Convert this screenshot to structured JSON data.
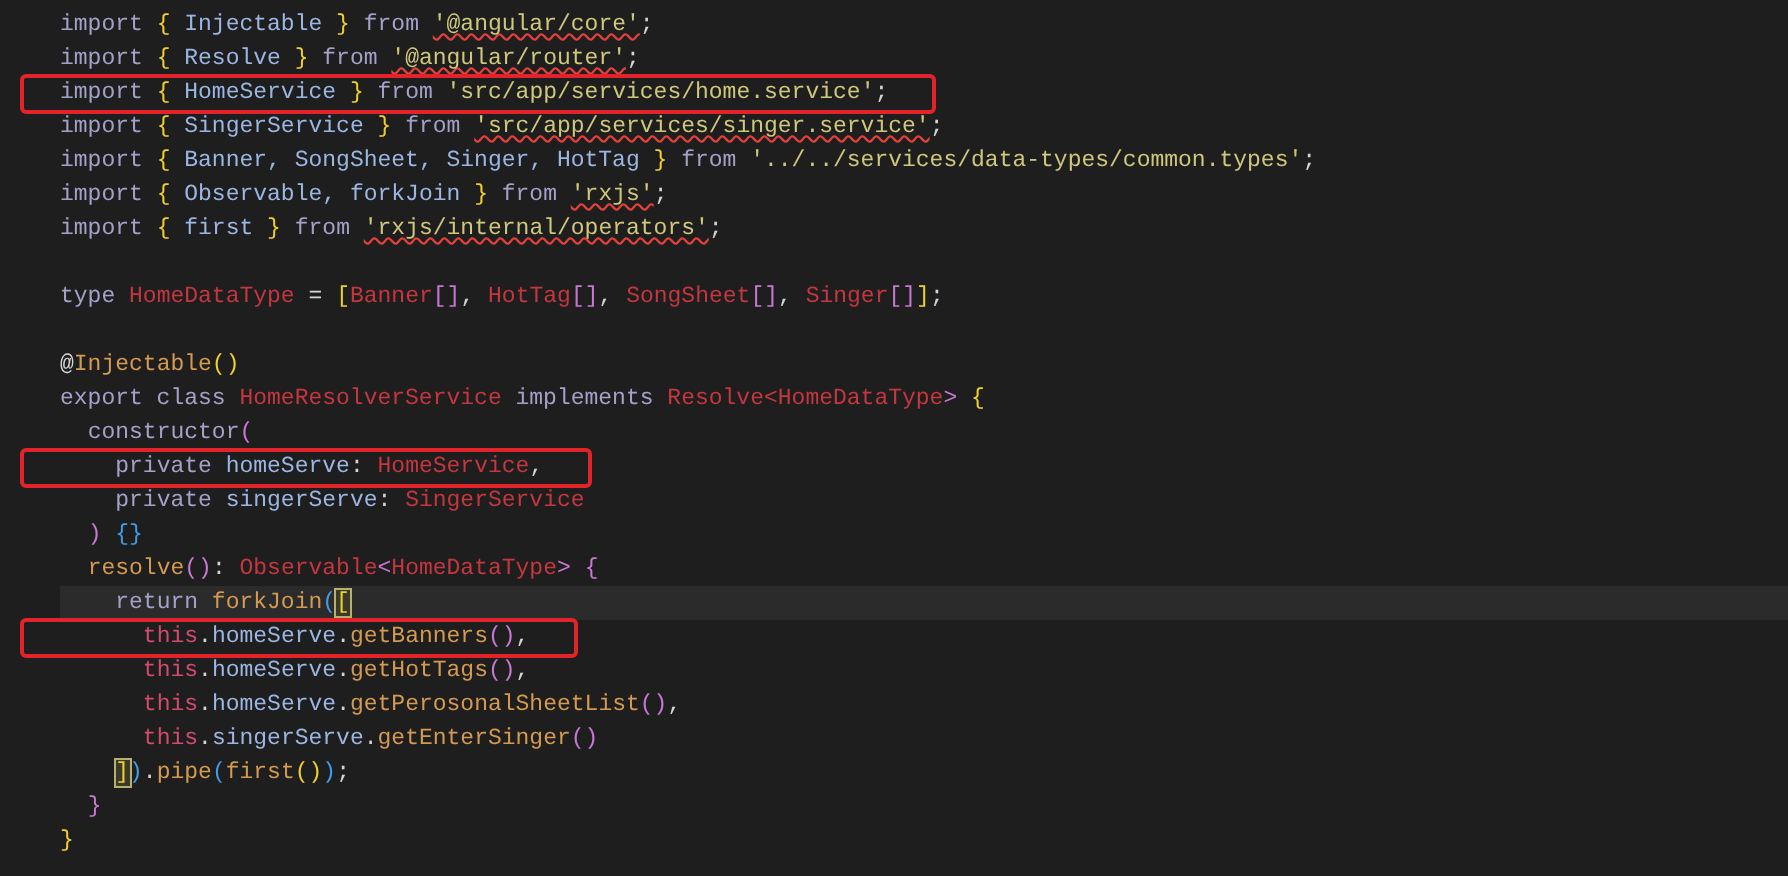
{
  "editor": {
    "lines": [
      {
        "kind": "code",
        "tokens": [
          {
            "text": "import ",
            "kind": "kw"
          },
          {
            "text": "{",
            "kind": "b1"
          },
          {
            "text": " Injectable ",
            "kind": "id"
          },
          {
            "text": "}",
            "kind": "b1"
          },
          {
            "text": " from ",
            "kind": "kw"
          },
          {
            "text": "'@angular/core'",
            "kind": "str",
            "squiggle": true
          },
          {
            "text": ";",
            "kind": "p"
          }
        ]
      },
      {
        "kind": "code",
        "tokens": [
          {
            "text": "import ",
            "kind": "kw"
          },
          {
            "text": "{",
            "kind": "b1"
          },
          {
            "text": " Resolve ",
            "kind": "id"
          },
          {
            "text": "}",
            "kind": "b1"
          },
          {
            "text": " from ",
            "kind": "kw"
          },
          {
            "text": "'@angular/router'",
            "kind": "str",
            "squiggle": true
          },
          {
            "text": ";",
            "kind": "p"
          }
        ]
      },
      {
        "kind": "code",
        "highlighted": true,
        "tokens": [
          {
            "text": "import ",
            "kind": "kw"
          },
          {
            "text": "{",
            "kind": "b1"
          },
          {
            "text": " HomeService ",
            "kind": "id"
          },
          {
            "text": "}",
            "kind": "b1"
          },
          {
            "text": " from ",
            "kind": "kw"
          },
          {
            "text": "'src/app/services/home.service'",
            "kind": "str"
          },
          {
            "text": ";",
            "kind": "p"
          }
        ]
      },
      {
        "kind": "code",
        "tokens": [
          {
            "text": "import ",
            "kind": "kw"
          },
          {
            "text": "{",
            "kind": "b1"
          },
          {
            "text": " SingerService ",
            "kind": "id"
          },
          {
            "text": "}",
            "kind": "b1"
          },
          {
            "text": " from ",
            "kind": "kw"
          },
          {
            "text": "'src/app/services/singer.service'",
            "kind": "str",
            "squiggle": true
          },
          {
            "text": ";",
            "kind": "p"
          }
        ]
      },
      {
        "kind": "code",
        "tokens": [
          {
            "text": "import ",
            "kind": "kw"
          },
          {
            "text": "{",
            "kind": "b1"
          },
          {
            "text": " Banner, SongSheet, Singer, HotTag ",
            "kind": "id"
          },
          {
            "text": "}",
            "kind": "b1"
          },
          {
            "text": " from ",
            "kind": "kw"
          },
          {
            "text": "'../../services/data-types/common.types'",
            "kind": "str"
          },
          {
            "text": ";",
            "kind": "p"
          }
        ]
      },
      {
        "kind": "code",
        "tokens": [
          {
            "text": "import ",
            "kind": "kw"
          },
          {
            "text": "{",
            "kind": "b1"
          },
          {
            "text": " Observable, forkJoin ",
            "kind": "id"
          },
          {
            "text": "}",
            "kind": "b1"
          },
          {
            "text": " from ",
            "kind": "kw"
          },
          {
            "text": "'rxjs'",
            "kind": "str",
            "squiggle": true
          },
          {
            "text": ";",
            "kind": "p"
          }
        ]
      },
      {
        "kind": "code",
        "tokens": [
          {
            "text": "import ",
            "kind": "kw"
          },
          {
            "text": "{",
            "kind": "b1"
          },
          {
            "text": " first ",
            "kind": "id"
          },
          {
            "text": "}",
            "kind": "b1"
          },
          {
            "text": " from ",
            "kind": "kw"
          },
          {
            "text": "'rxjs/internal/operators'",
            "kind": "str",
            "squiggle": true
          },
          {
            "text": ";",
            "kind": "p"
          }
        ]
      },
      {
        "kind": "blank"
      },
      {
        "kind": "code",
        "tokens": [
          {
            "text": "type ",
            "kind": "kw"
          },
          {
            "text": "HomeDataType",
            "kind": "type"
          },
          {
            "text": " = ",
            "kind": "p"
          },
          {
            "text": "[",
            "kind": "b1"
          },
          {
            "text": "Banner",
            "kind": "type"
          },
          {
            "text": "[]",
            "kind": "b2"
          },
          {
            "text": ", ",
            "kind": "p"
          },
          {
            "text": "HotTag",
            "kind": "type"
          },
          {
            "text": "[]",
            "kind": "b2"
          },
          {
            "text": ", ",
            "kind": "p"
          },
          {
            "text": "SongSheet",
            "kind": "type"
          },
          {
            "text": "[]",
            "kind": "b2"
          },
          {
            "text": ", ",
            "kind": "p"
          },
          {
            "text": "Singer",
            "kind": "type"
          },
          {
            "text": "[]",
            "kind": "b2"
          },
          {
            "text": "]",
            "kind": "b1"
          },
          {
            "text": ";",
            "kind": "p"
          }
        ]
      },
      {
        "kind": "blank"
      },
      {
        "kind": "code",
        "tokens": [
          {
            "text": "@",
            "kind": "p"
          },
          {
            "text": "Injectable",
            "kind": "fn"
          },
          {
            "text": "()",
            "kind": "b1"
          }
        ]
      },
      {
        "kind": "code",
        "tokens": [
          {
            "text": "export class ",
            "kind": "kw"
          },
          {
            "text": "HomeResolverService",
            "kind": "type"
          },
          {
            "text": " implements ",
            "kind": "kw"
          },
          {
            "text": "Resolve",
            "kind": "type"
          },
          {
            "text": "<",
            "kind": "type"
          },
          {
            "text": "HomeDataType",
            "kind": "type"
          },
          {
            "text": "> ",
            "kind": "b2"
          },
          {
            "text": "{",
            "kind": "b1"
          }
        ]
      },
      {
        "kind": "code",
        "tokens": [
          {
            "text": "  constructor",
            "kind": "kw"
          },
          {
            "text": "(",
            "kind": "b2"
          }
        ]
      },
      {
        "kind": "code",
        "highlighted": true,
        "tokens": [
          {
            "text": "    private ",
            "kind": "kw"
          },
          {
            "text": "homeServe",
            "kind": "id"
          },
          {
            "text": ": ",
            "kind": "p"
          },
          {
            "text": "HomeService",
            "kind": "type"
          },
          {
            "text": ",",
            "kind": "p"
          }
        ]
      },
      {
        "kind": "code",
        "tokens": [
          {
            "text": "    private ",
            "kind": "kw"
          },
          {
            "text": "singerServe",
            "kind": "id"
          },
          {
            "text": ": ",
            "kind": "p"
          },
          {
            "text": "SingerService",
            "kind": "type"
          }
        ]
      },
      {
        "kind": "code",
        "tokens": [
          {
            "text": "  ) ",
            "kind": "b2"
          },
          {
            "text": "{}",
            "kind": "b3"
          }
        ]
      },
      {
        "kind": "code",
        "tokens": [
          {
            "text": "  resolve",
            "kind": "fn"
          },
          {
            "text": "()",
            "kind": "b2"
          },
          {
            "text": ": ",
            "kind": "p"
          },
          {
            "text": "Observable",
            "kind": "type"
          },
          {
            "text": "<",
            "kind": "b2"
          },
          {
            "text": "HomeDataType",
            "kind": "type"
          },
          {
            "text": ">",
            "kind": "b2"
          },
          {
            "text": " {",
            "kind": "b2"
          }
        ]
      },
      {
        "kind": "code",
        "current": true,
        "tokens": [
          {
            "text": "    return ",
            "kind": "kw"
          },
          {
            "text": "forkJoin",
            "kind": "fn"
          },
          {
            "text": "(",
            "kind": "b3"
          },
          {
            "text": "[",
            "kind": "b1",
            "matched": true
          }
        ]
      },
      {
        "kind": "code",
        "highlighted": true,
        "tokens": [
          {
            "text": "      this",
            "kind": "this"
          },
          {
            "text": ".",
            "kind": "p"
          },
          {
            "text": "homeServe",
            "kind": "id"
          },
          {
            "text": ".",
            "kind": "p"
          },
          {
            "text": "getBanners",
            "kind": "fn"
          },
          {
            "text": "()",
            "kind": "b2"
          },
          {
            "text": ",",
            "kind": "p"
          }
        ]
      },
      {
        "kind": "code",
        "tokens": [
          {
            "text": "      this",
            "kind": "this"
          },
          {
            "text": ".",
            "kind": "p"
          },
          {
            "text": "homeServe",
            "kind": "id"
          },
          {
            "text": ".",
            "kind": "p"
          },
          {
            "text": "getHotTags",
            "kind": "fn"
          },
          {
            "text": "()",
            "kind": "b2"
          },
          {
            "text": ",",
            "kind": "p"
          }
        ]
      },
      {
        "kind": "code",
        "tokens": [
          {
            "text": "      this",
            "kind": "this"
          },
          {
            "text": ".",
            "kind": "p"
          },
          {
            "text": "homeServe",
            "kind": "id"
          },
          {
            "text": ".",
            "kind": "p"
          },
          {
            "text": "getPerosonalSheetList",
            "kind": "fn"
          },
          {
            "text": "()",
            "kind": "b2"
          },
          {
            "text": ",",
            "kind": "p"
          }
        ]
      },
      {
        "kind": "code",
        "tokens": [
          {
            "text": "      this",
            "kind": "this"
          },
          {
            "text": ".",
            "kind": "p"
          },
          {
            "text": "singerServe",
            "kind": "id"
          },
          {
            "text": ".",
            "kind": "p"
          },
          {
            "text": "getEnterSinger",
            "kind": "fn"
          },
          {
            "text": "()",
            "kind": "b2"
          }
        ]
      },
      {
        "kind": "code",
        "tokens": [
          {
            "text": "    ]",
            "kind": "b1",
            "matched": true
          },
          {
            "text": ")",
            "kind": "b3"
          },
          {
            "text": ".",
            "kind": "p"
          },
          {
            "text": "pipe",
            "kind": "fn"
          },
          {
            "text": "(",
            "kind": "b3"
          },
          {
            "text": "first",
            "kind": "fn"
          },
          {
            "text": "()",
            "kind": "b1"
          },
          {
            "text": ")",
            "kind": "b3"
          },
          {
            "text": ";",
            "kind": "p"
          }
        ]
      },
      {
        "kind": "code",
        "tokens": [
          {
            "text": "  }",
            "kind": "b2"
          }
        ]
      },
      {
        "kind": "code",
        "tokens": [
          {
            "text": "}",
            "kind": "b1"
          }
        ]
      }
    ]
  }
}
